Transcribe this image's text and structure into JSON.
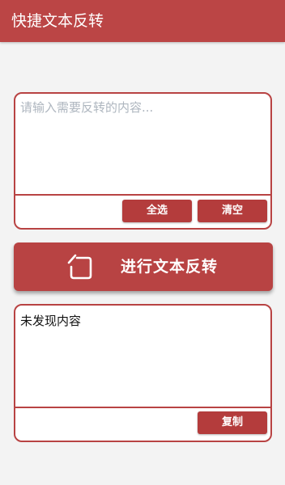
{
  "appbar": {
    "title": "快捷文本反转"
  },
  "input_card": {
    "placeholder": "请输入需要反转的内容...",
    "value": "",
    "select_all_label": "全选",
    "clear_label": "清空"
  },
  "reverse_button": {
    "label": "进行文本反转",
    "icon": "rotate-icon"
  },
  "output_card": {
    "text": "未发现内容",
    "copy_label": "复制"
  },
  "colors": {
    "accent": "#bb4545",
    "background": "#f3f3f3"
  }
}
